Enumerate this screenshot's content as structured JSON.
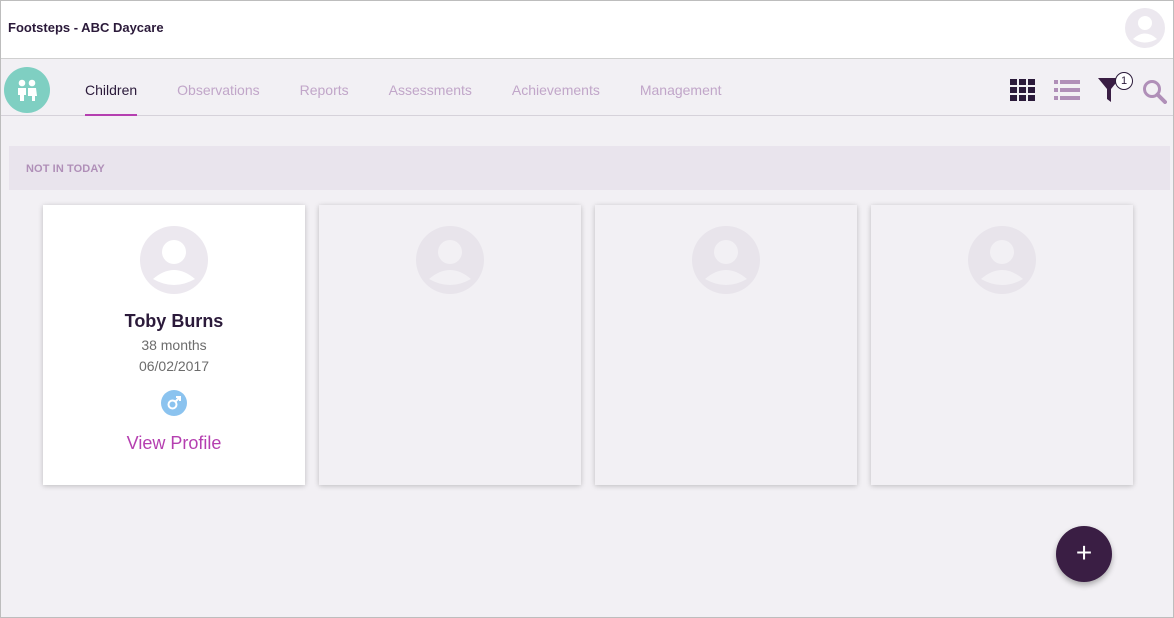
{
  "header": {
    "app_title": "Footsteps - ABC Daycare"
  },
  "nav": {
    "tabs": [
      {
        "label": "Children",
        "active": true
      },
      {
        "label": "Observations",
        "active": false
      },
      {
        "label": "Reports",
        "active": false
      },
      {
        "label": "Assessments",
        "active": false
      },
      {
        "label": "Achievements",
        "active": false
      },
      {
        "label": "Management",
        "active": false
      }
    ],
    "filter_count": "1"
  },
  "section": {
    "title": "NOT IN TODAY"
  },
  "children": [
    {
      "name": "Toby Burns",
      "age": "38 months",
      "dob": "06/02/2017",
      "gender": "male",
      "action": "View Profile"
    }
  ],
  "fab": {
    "label": "+"
  },
  "colors": {
    "accent": "#b53fb0",
    "dark": "#2b1a3a",
    "logo": "#7fcfc2",
    "gender_male": "#8bc3ef"
  },
  "icons": {
    "logo": "children-icon",
    "top_avatar": "user-avatar-icon",
    "grid_view": "grid-view-icon",
    "list_view": "list-view-icon",
    "filter": "filter-icon",
    "search": "search-icon",
    "gender": "male-icon"
  }
}
